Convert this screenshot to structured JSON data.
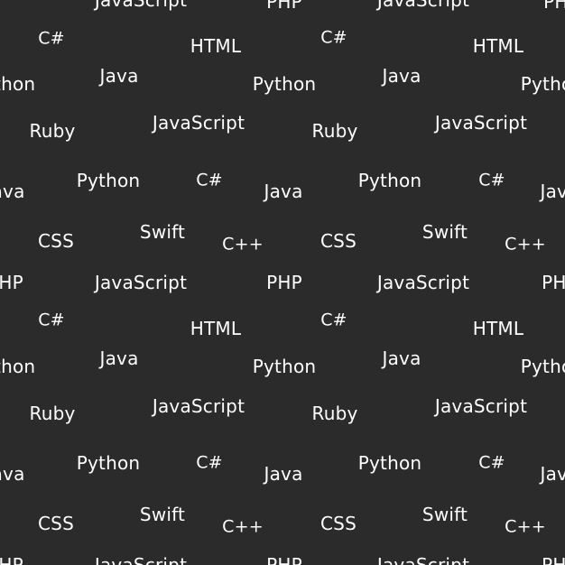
{
  "words": [
    "JavaScript",
    "PHP",
    "JavaScript",
    "PHP",
    "C#",
    "HTML",
    "C#",
    "HTML",
    "Python",
    "Java",
    "Python",
    "Java",
    "Python",
    "Ruby",
    "JavaScript",
    "Ruby",
    "JavaScript",
    "Java",
    "Python",
    "C#",
    "Java",
    "Python",
    "C#",
    "Java",
    "CSS",
    "Swift",
    "C++",
    "CSS",
    "Swift",
    "C++",
    "PHP",
    "JavaScript",
    "PHP",
    "JavaScript",
    "PHP",
    "C#",
    "HTML",
    "C#",
    "HTML",
    "Python",
    "Java",
    "Python",
    "Java",
    "Python",
    "Ruby",
    "JavaScript",
    "Ruby",
    "JavaScript",
    "Java",
    "Python",
    "C#",
    "Java",
    "Python",
    "C#",
    "Java",
    "CSS",
    "Swift",
    "C++",
    "CSS",
    "Swift",
    "C++",
    "PHP",
    "JavaScript",
    "PHP",
    "JavaScript",
    "PHP"
  ]
}
